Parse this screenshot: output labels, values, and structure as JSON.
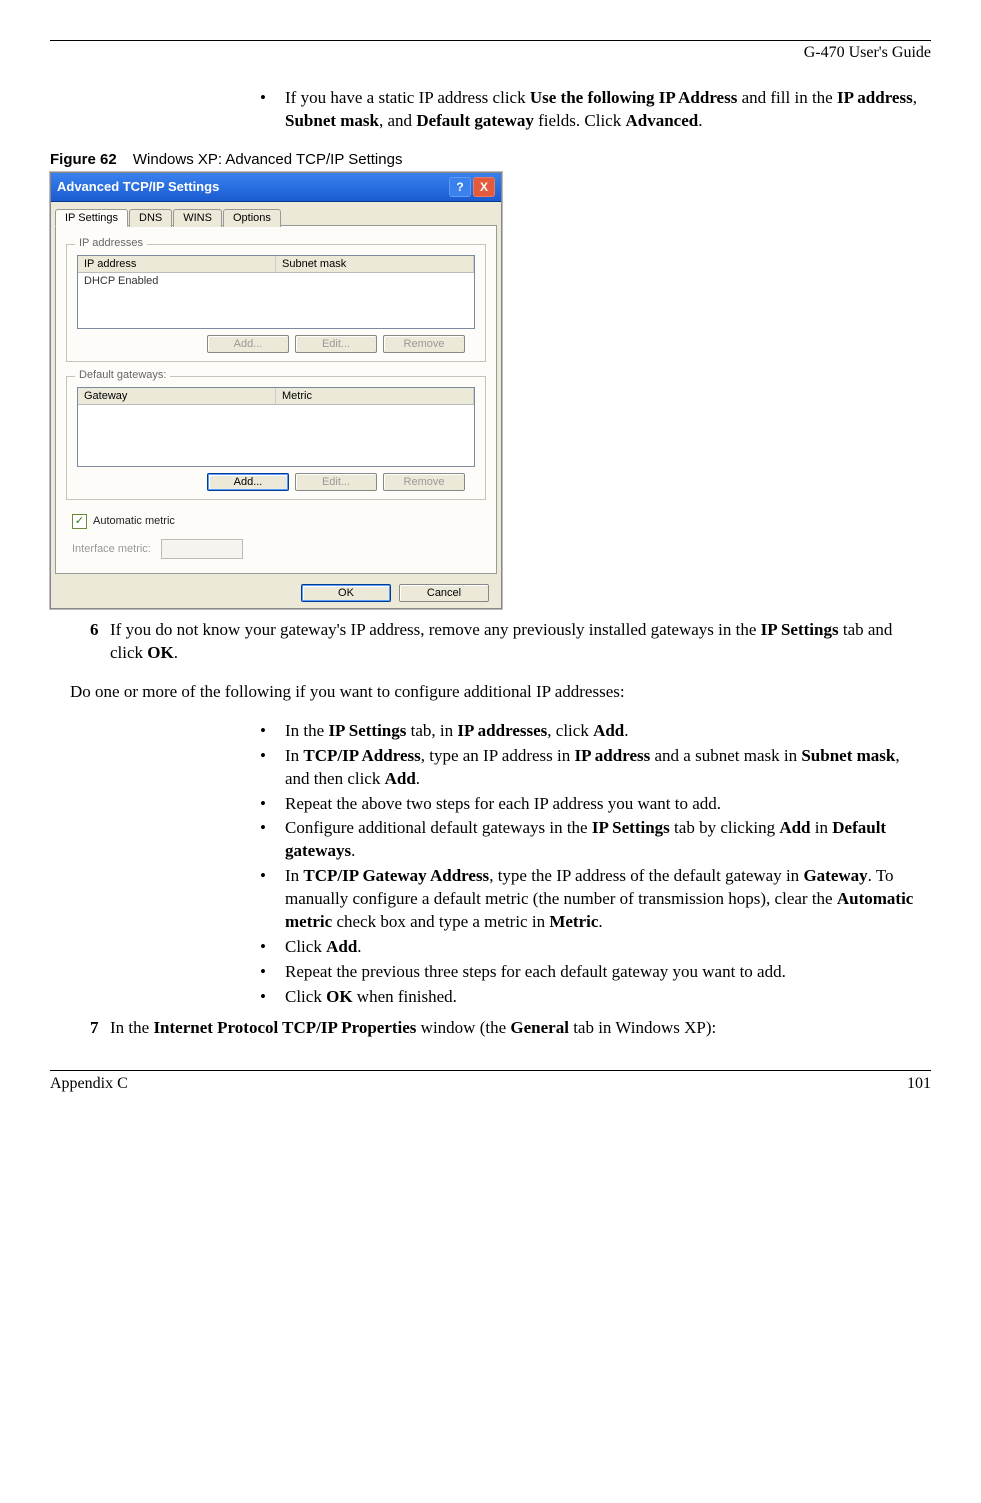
{
  "header": {
    "guide_title": "G-470 User's Guide"
  },
  "intro_bullet": {
    "segments": [
      {
        "t": "If you have a static IP address click ",
        "b": false
      },
      {
        "t": "Use the following IP Address",
        "b": true
      },
      {
        "t": " and fill in the ",
        "b": false
      },
      {
        "t": "IP address",
        "b": true
      },
      {
        "t": ", ",
        "b": false
      },
      {
        "t": "Subnet mask",
        "b": true
      },
      {
        "t": ", and ",
        "b": false
      },
      {
        "t": "Default gateway",
        "b": true
      },
      {
        "t": " fields. Click ",
        "b": false
      },
      {
        "t": "Advanced",
        "b": true
      },
      {
        "t": ".",
        "b": false
      }
    ]
  },
  "figure": {
    "number": "Figure 62",
    "caption": "Windows XP: Advanced TCP/IP Settings"
  },
  "xp": {
    "title": "Advanced TCP/IP Settings",
    "help_icon": "?",
    "close_icon": "X",
    "tabs": [
      "IP Settings",
      "DNS",
      "WINS",
      "Options"
    ],
    "group_ip": {
      "label": "IP addresses",
      "col1": "IP address",
      "col2": "Subnet mask",
      "row1": "DHCP Enabled",
      "add": "Add...",
      "edit": "Edit...",
      "remove": "Remove"
    },
    "group_gw": {
      "label": "Default gateways:",
      "col1": "Gateway",
      "col2": "Metric",
      "add": "Add...",
      "edit": "Edit...",
      "remove": "Remove"
    },
    "auto_metric_label": "Automatic metric",
    "interface_metric_label": "Interface metric:",
    "ok": "OK",
    "cancel": "Cancel"
  },
  "step6": {
    "num": "6",
    "segments": [
      {
        "t": "If you do not know your gateway's IP address, remove any previously installed gateways in the ",
        "b": false
      },
      {
        "t": "IP Settings",
        "b": true
      },
      {
        "t": " tab and click ",
        "b": false
      },
      {
        "t": "OK",
        "b": true
      },
      {
        "t": ".",
        "b": false
      }
    ]
  },
  "para_additional": "Do one or more of the following if you want to configure additional IP addresses:",
  "bullets2": [
    [
      {
        "t": "In the ",
        "b": false
      },
      {
        "t": "IP Settings",
        "b": true
      },
      {
        "t": " tab, in ",
        "b": false
      },
      {
        "t": "IP addresses",
        "b": true
      },
      {
        "t": ", click ",
        "b": false
      },
      {
        "t": "Add",
        "b": true
      },
      {
        "t": ".",
        "b": false
      }
    ],
    [
      {
        "t": "In ",
        "b": false
      },
      {
        "t": "TCP/IP Address",
        "b": true
      },
      {
        "t": ", type an IP address in ",
        "b": false
      },
      {
        "t": "IP address",
        "b": true
      },
      {
        "t": " and a subnet mask in ",
        "b": false
      },
      {
        "t": "Subnet mask",
        "b": true
      },
      {
        "t": ", and then click ",
        "b": false
      },
      {
        "t": "Add",
        "b": true
      },
      {
        "t": ".",
        "b": false
      }
    ],
    [
      {
        "t": "Repeat the above two steps for each IP address you want to add.",
        "b": false
      }
    ],
    [
      {
        "t": "Configure additional default gateways in the ",
        "b": false
      },
      {
        "t": "IP Settings",
        "b": true
      },
      {
        "t": " tab by clicking ",
        "b": false
      },
      {
        "t": "Add",
        "b": true
      },
      {
        "t": " in ",
        "b": false
      },
      {
        "t": "Default gateways",
        "b": true
      },
      {
        "t": ".",
        "b": false
      }
    ],
    [
      {
        "t": "In ",
        "b": false
      },
      {
        "t": "TCP/IP Gateway Address",
        "b": true
      },
      {
        "t": ", type the IP address of the default gateway in ",
        "b": false
      },
      {
        "t": "Gateway",
        "b": true
      },
      {
        "t": ". To manually configure a default metric (the number of transmission hops), clear the ",
        "b": false
      },
      {
        "t": "Automatic metric",
        "b": true
      },
      {
        "t": " check box and type a metric in ",
        "b": false
      },
      {
        "t": "Metric",
        "b": true
      },
      {
        "t": ".",
        "b": false
      }
    ],
    [
      {
        "t": "Click ",
        "b": false
      },
      {
        "t": "Add",
        "b": true
      },
      {
        "t": ".",
        "b": false
      }
    ],
    [
      {
        "t": "Repeat the previous three steps for each default gateway you want to add.",
        "b": false
      }
    ],
    [
      {
        "t": "Click ",
        "b": false
      },
      {
        "t": "OK",
        "b": true
      },
      {
        "t": " when finished.",
        "b": false
      }
    ]
  ],
  "step7": {
    "num": "7",
    "segments": [
      {
        "t": "In the ",
        "b": false
      },
      {
        "t": "Internet Protocol TCP/IP Properties",
        "b": true
      },
      {
        "t": " window (the ",
        "b": false
      },
      {
        "t": "General",
        "b": true
      },
      {
        "t": " tab in Windows XP):",
        "b": false
      }
    ]
  },
  "footer": {
    "left": "Appendix C",
    "right": "101"
  }
}
